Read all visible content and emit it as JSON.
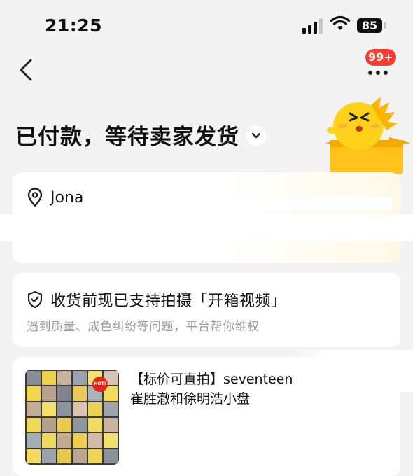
{
  "status_bar": {
    "time": "21:25",
    "battery": "85"
  },
  "header": {
    "notification_badge": "99+"
  },
  "order": {
    "status_title": "已付款，等待卖家发货"
  },
  "address": {
    "name": "Jona"
  },
  "unboxing": {
    "title": "收货前现已支持拍摄「开箱视频」",
    "subtitle": "遇到质量、成色纠纷等问题，平台帮你维权"
  },
  "product": {
    "title_line1": "【标价可直拍】seventeen",
    "title_line2": "崔胜澈和徐明浩小盘",
    "hot_tag": "HOT!"
  },
  "colors": {
    "accent_yellow": "#ffd21a",
    "badge_red": "#ff3b30",
    "page_bg": "#f3f3f3"
  },
  "icons": {
    "back": "chevron-left-icon",
    "more": "more-dots-icon",
    "expand": "chevron-down-icon",
    "location": "location-pin-icon",
    "shield": "shield-check-icon"
  }
}
